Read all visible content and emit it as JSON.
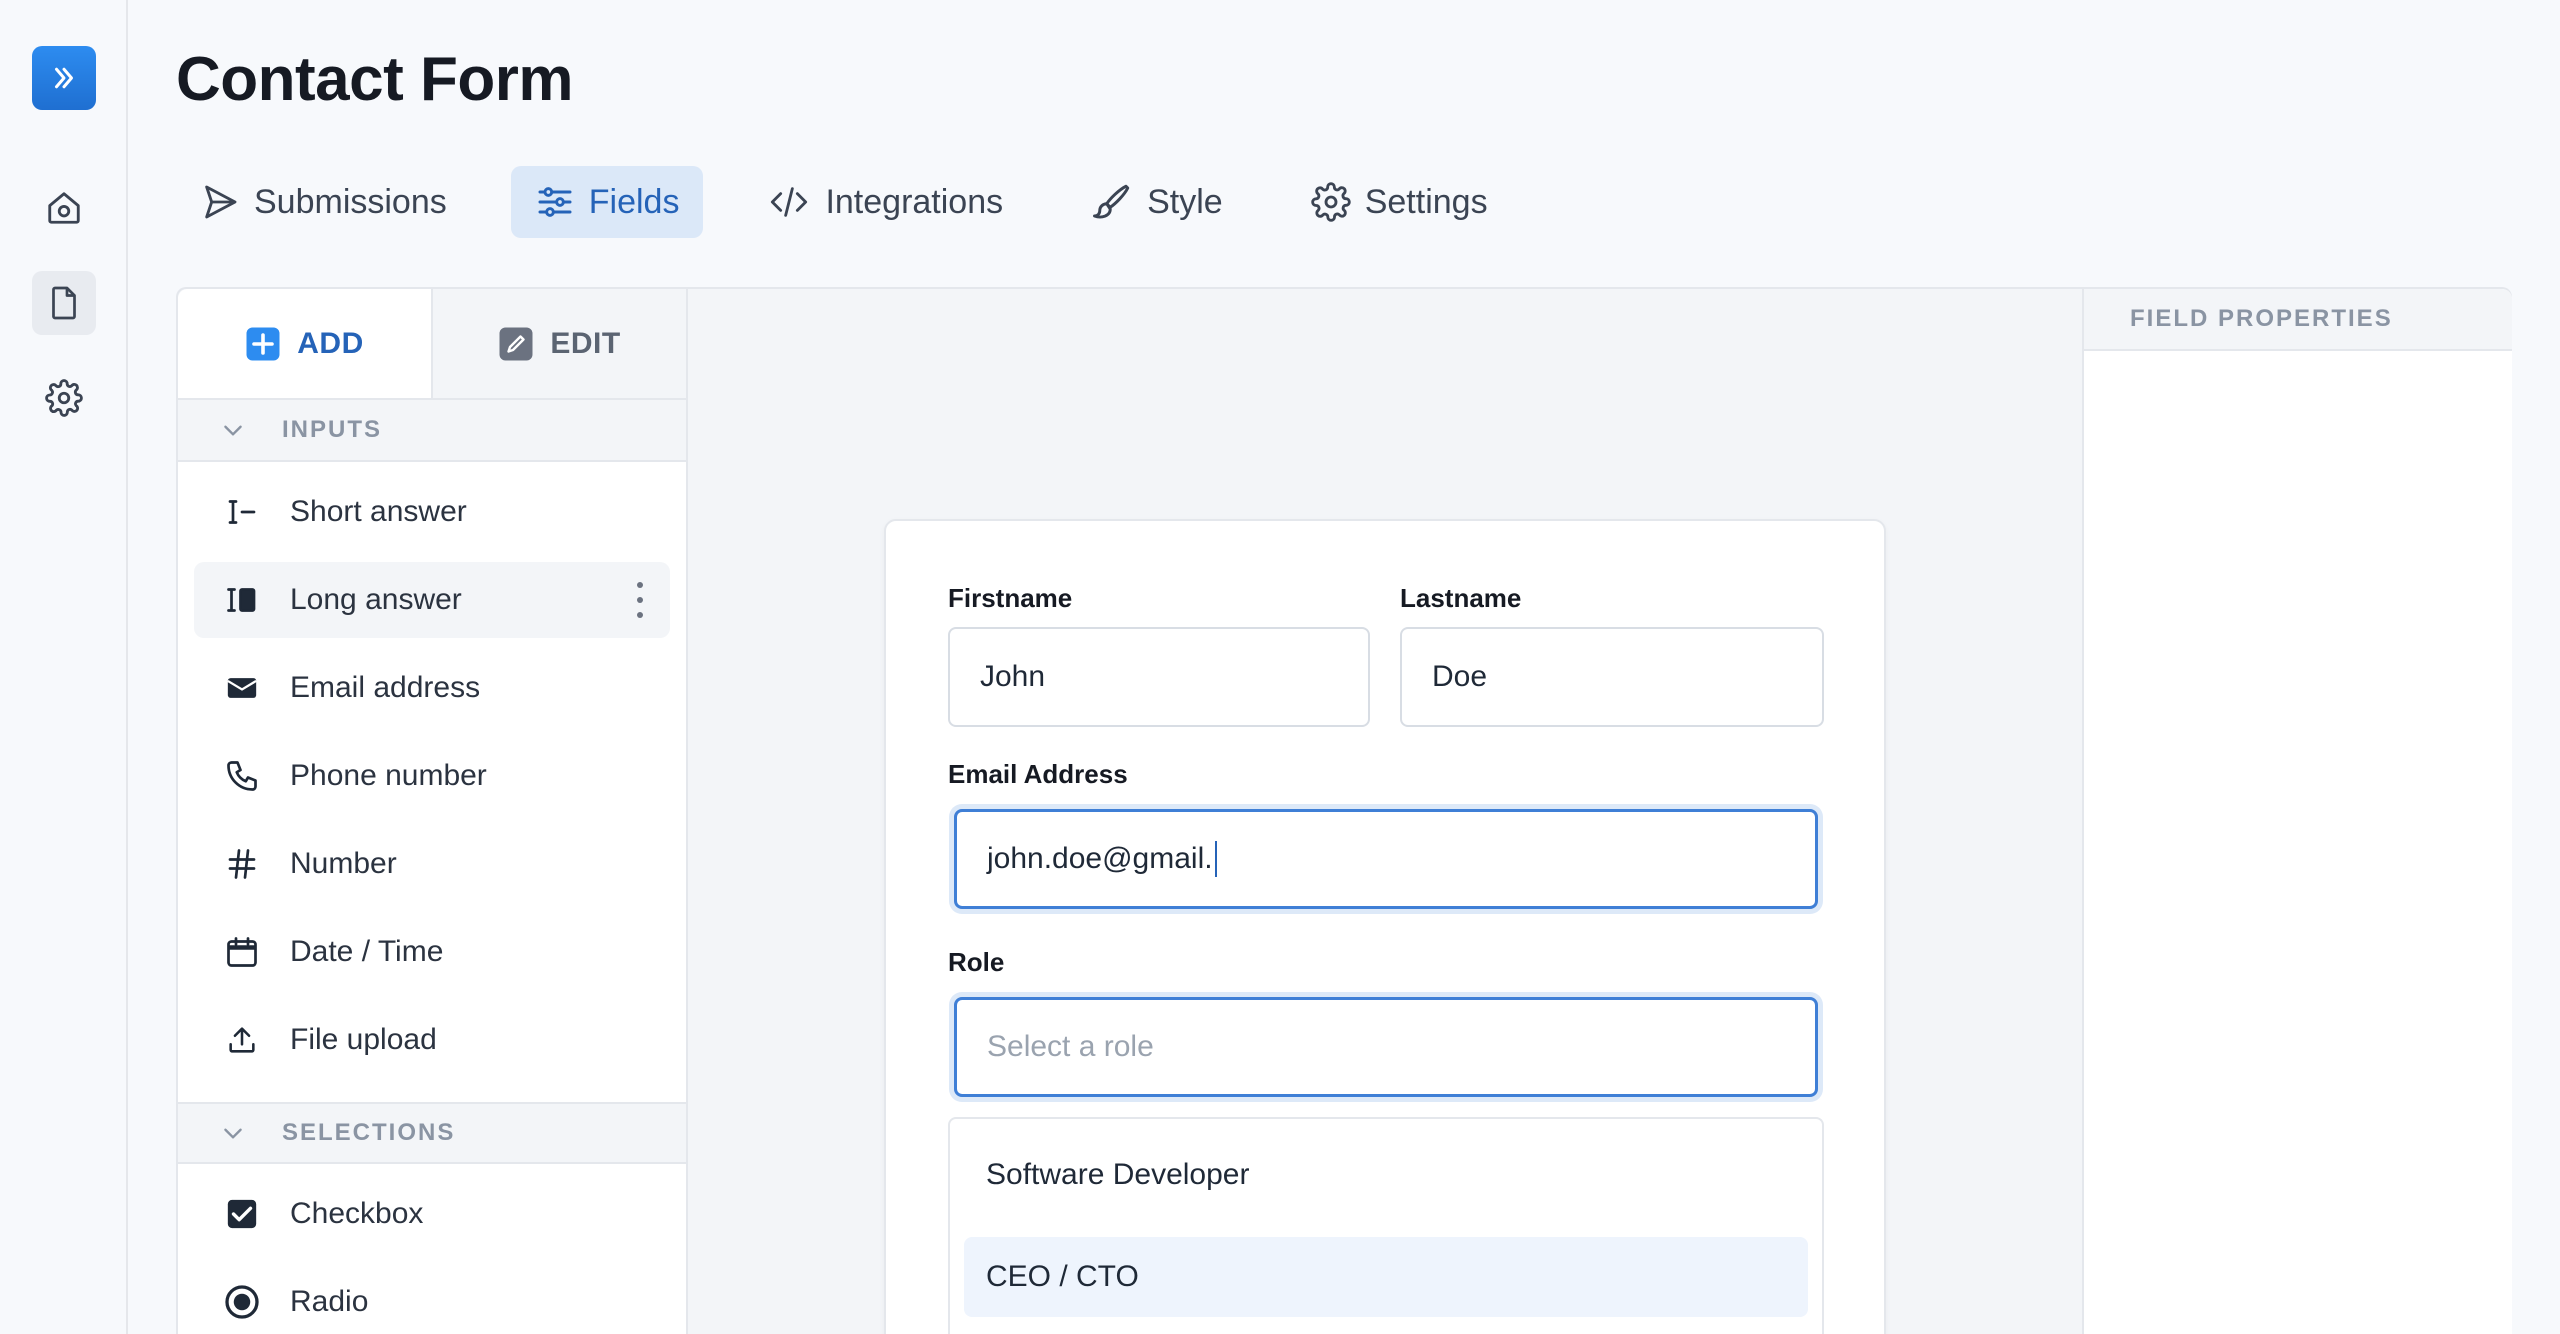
{
  "page": {
    "title": "Contact Form"
  },
  "rail": {
    "items": [
      "expand-icon",
      "home-icon",
      "document-icon",
      "gear-icon"
    ]
  },
  "tabs": [
    {
      "label": "Submissions",
      "icon": "send-icon"
    },
    {
      "label": "Fields",
      "icon": "sliders-icon",
      "active": true
    },
    {
      "label": "Integrations",
      "icon": "code-icon"
    },
    {
      "label": "Style",
      "icon": "brush-icon"
    },
    {
      "label": "Settings",
      "icon": "gear-icon"
    }
  ],
  "panel": {
    "add_label": "ADD",
    "edit_label": "EDIT",
    "inputs_header": "INPUTS",
    "inputs": [
      {
        "label": "Short answer",
        "icon": "text-cursor-icon"
      },
      {
        "label": "Long answer",
        "icon": "text-block-icon"
      },
      {
        "label": "Email address",
        "icon": "envelope-icon"
      },
      {
        "label": "Phone number",
        "icon": "phone-icon"
      },
      {
        "label": "Number",
        "icon": "hash-icon"
      },
      {
        "label": "Date / Time",
        "icon": "calendar-icon"
      },
      {
        "label": "File upload",
        "icon": "upload-icon"
      }
    ],
    "selections_header": "SELECTIONS",
    "selections": [
      {
        "label": "Checkbox",
        "icon": "checkbox-icon"
      },
      {
        "label": "Radio",
        "icon": "radio-icon"
      }
    ]
  },
  "properties": {
    "header": "FIELD PROPERTIES"
  },
  "form": {
    "firstname": {
      "label": "Firstname",
      "value": "John"
    },
    "lastname": {
      "label": "Lastname",
      "value": "Doe"
    },
    "email": {
      "label": "Email Address",
      "value": "john.doe@gmail."
    },
    "role": {
      "label": "Role",
      "placeholder": "Select a role",
      "options": [
        "Software Developer",
        "CEO / CTO"
      ],
      "highlighted": "CEO / CTO"
    }
  },
  "colors": {
    "accent": "#2563b8",
    "active_tab_bg": "#dbe8f8",
    "logo": "#1f6fd1"
  }
}
